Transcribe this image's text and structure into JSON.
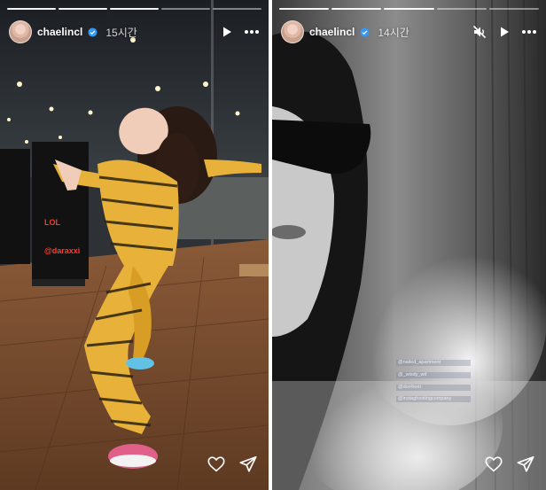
{
  "stories": [
    {
      "username": "chaelincl",
      "timestamp": "15시간",
      "tag_lines": [
        "LOL",
        "@daraxxi"
      ],
      "icons": [
        "verified-badge-icon",
        "play-icon",
        "more-icon",
        "heart-icon",
        "send-icon"
      ]
    },
    {
      "username": "chaelincl",
      "timestamp": "14시간",
      "sticker_lines": [
        "@nailed_apartment",
        "@_wisdy_wd",
        "@dorrhom",
        "@instaghostingcompany"
      ],
      "icons": [
        "verified-badge-icon",
        "mute-icon",
        "play-icon",
        "more-icon",
        "heart-icon",
        "send-icon"
      ]
    }
  ],
  "colors": {
    "verified_badge": "#3897f0",
    "tag_text": "#ff3b2f",
    "divider": "#ffffff"
  }
}
